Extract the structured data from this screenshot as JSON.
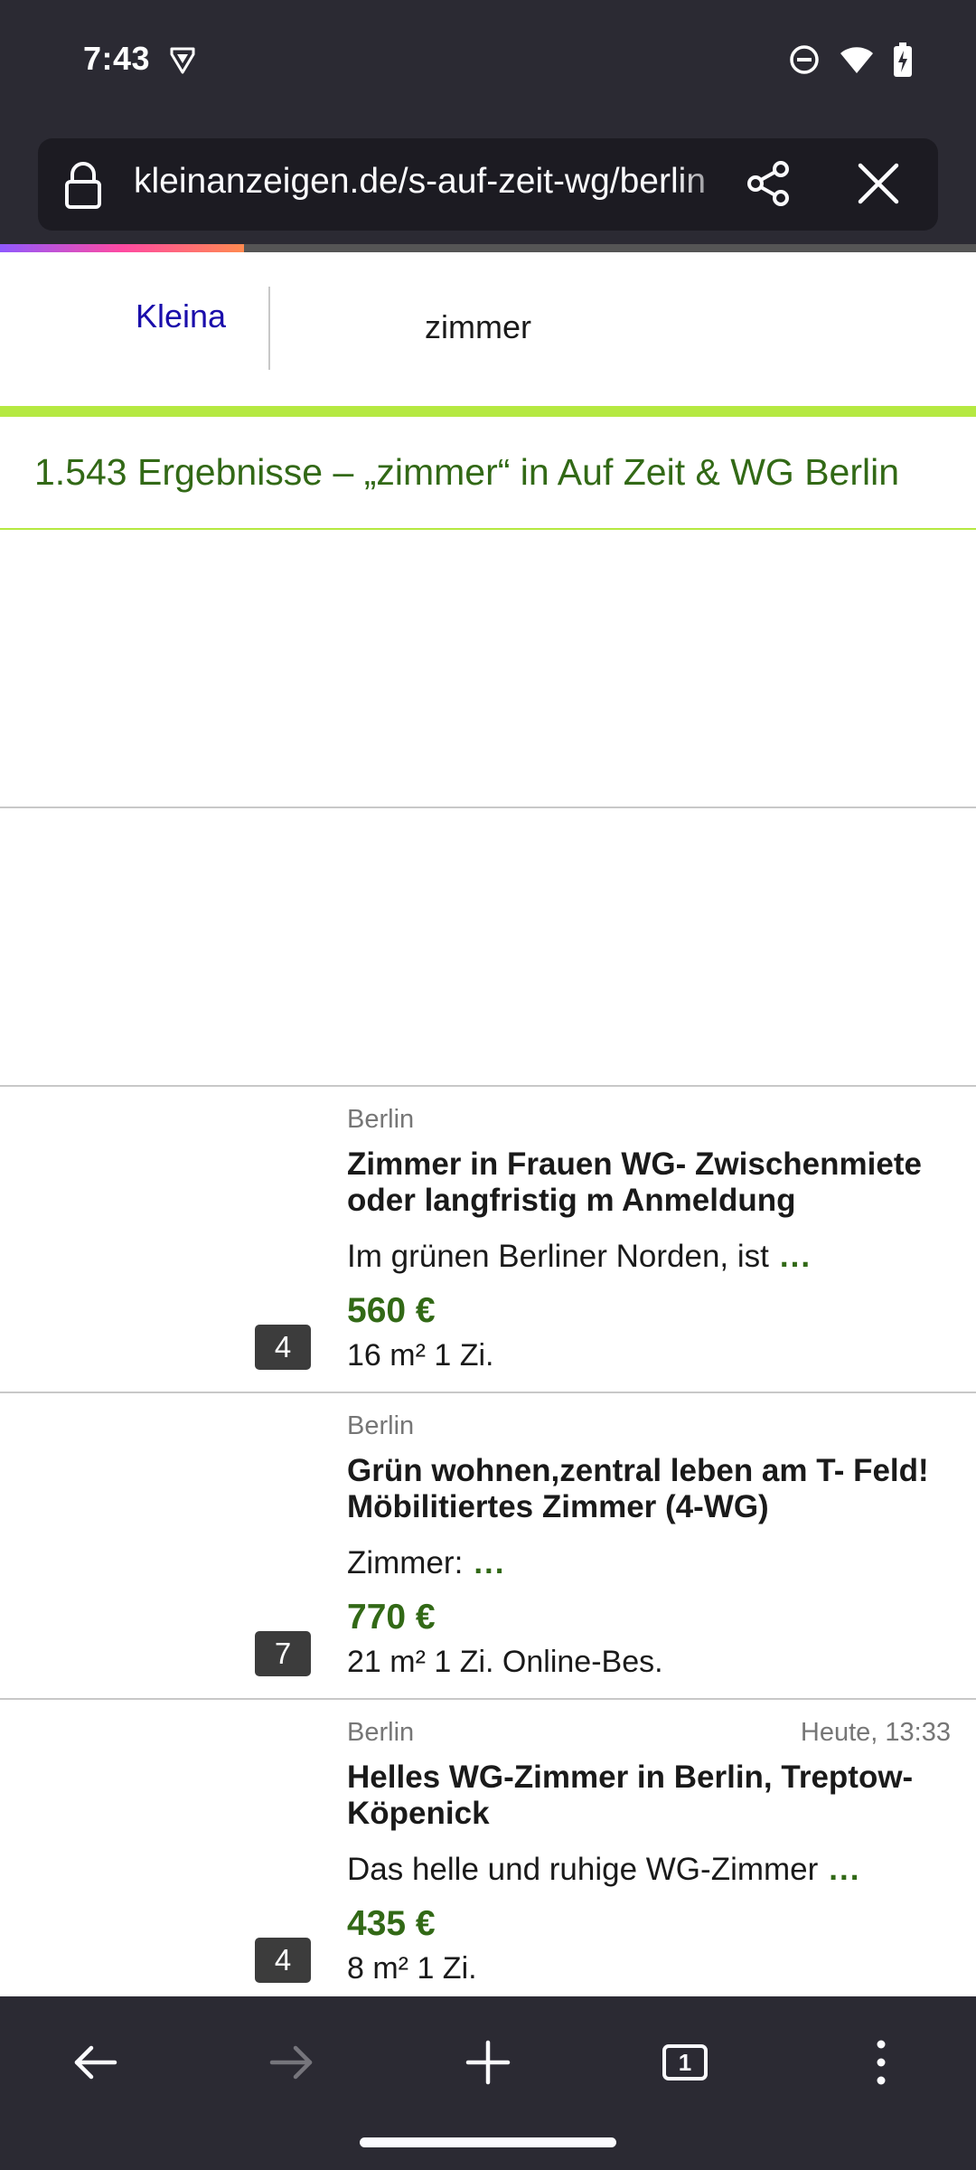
{
  "status_bar": {
    "time": "7:43",
    "icons": [
      "vpn-shield-icon",
      "do-not-disturb-icon",
      "wifi-icon",
      "battery-charging-icon"
    ]
  },
  "browser": {
    "url": "kleinanzeigen.de/s-auf-zeit-wg/berlin",
    "icons": [
      "lock-icon",
      "share-icon",
      "close-icon"
    ],
    "accent_colors": [
      "#9059ff",
      "#ff4aa2",
      "#ff8a50"
    ],
    "load_progress": 0.25
  },
  "site_header": {
    "logo_link": "Kleina",
    "search_term": "zimmer",
    "brand_color": "#b5e941"
  },
  "results": {
    "heading": "1.543 Ergebnisse – „zimmer“ in Auf Zeit & WG Berlin",
    "accent_color": "#326916"
  },
  "listings": [
    {
      "location": "Berlin",
      "posted": "",
      "title": "Zimmer in Frauen WG- Zwischenmiete oder langfristig m Anmeldung",
      "description": "Im grünen Berliner Norden, ist",
      "more": "...",
      "price": "560 €",
      "details": "16 m² 1 Zi.",
      "image_count": "4"
    },
    {
      "location": "Berlin",
      "posted": "",
      "title": "Grün wohnen,zentral leben am T- Feld! Möbilitiertes Zimmer (4-WG)",
      "description": "Zimmer:",
      "more": "...",
      "price": "770 €",
      "details": "21 m² 1 Zi. Online-Bes.",
      "image_count": "7"
    },
    {
      "location": "Berlin",
      "posted": "Heute, 13:33",
      "title": "Helles WG-Zimmer in Berlin, Treptow-Köpenick",
      "description": "Das helle und ruhige WG-Zimmer",
      "more": "...",
      "price": "435 €",
      "details": "8 m² 1 Zi.",
      "image_count": "4"
    }
  ],
  "bottom_nav": {
    "icons": [
      "back-arrow-icon",
      "forward-arrow-icon",
      "new-tab-plus-icon",
      "tab-counter-icon",
      "menu-dots-icon"
    ],
    "tab_count": "1"
  }
}
